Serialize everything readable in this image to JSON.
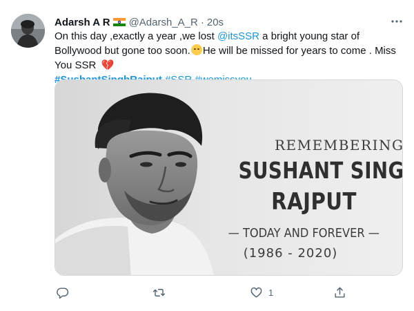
{
  "tweet": {
    "author_name": "Adarsh A R",
    "handle": "@Adarsh_A_R",
    "separator": "·",
    "time": "20s",
    "text_part1": "On this day ,exactly a year ,we lost ",
    "mention": "@itsSSR",
    "text_part2": " a bright young star of Bollywood but gone too soon.",
    "text_part3": "He will be missed for years to come . Miss You SSR ",
    "hashtag_main": "#SushantSinghRajput",
    "hashtag_2": "#SSR",
    "hashtag_3": "#wemissyou",
    "emoji_1": "face-with-rolling-eyes-emoji",
    "emoji_2": "broken-heart-emoji"
  },
  "media": {
    "line1": "REMEMBERING",
    "line2": "SUSHANT SINGH",
    "line3": "RAJPUT",
    "line4": "— TODAY AND FOREVER —",
    "line5": "(1986 - 2020)"
  },
  "actions": {
    "reply_icon": "reply-icon",
    "retweet_icon": "retweet-icon",
    "like_icon": "heart-icon",
    "like_count": "1",
    "share_icon": "share-icon",
    "more_icon": "more-horizontal-icon"
  },
  "colors": {
    "link": "#1b95e0",
    "text": "#0f1419",
    "muted": "#536471",
    "media_bg": "#ededed"
  }
}
